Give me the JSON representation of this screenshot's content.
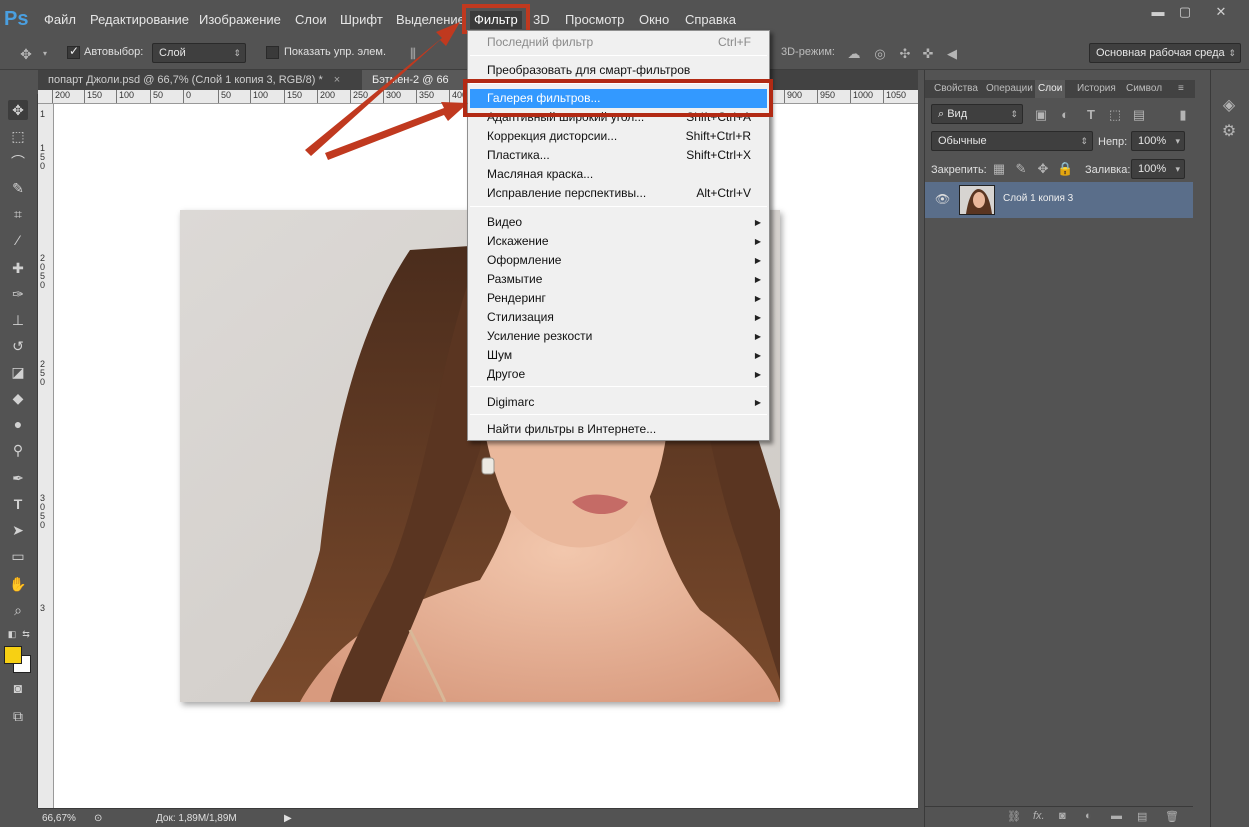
{
  "app": {
    "logo": "Ps",
    "window_controls": [
      "minimize-icon",
      "restore-icon",
      "close-icon"
    ]
  },
  "menubar": {
    "items": [
      "Файл",
      "Редактирование",
      "Изображение",
      "Слои",
      "Шрифт",
      "Выделение",
      "Фильтр",
      "3D",
      "Просмотр",
      "Окно",
      "Справка"
    ],
    "active": "Фильтр"
  },
  "options": {
    "auto_select_label": "Автовыбор:",
    "auto_select_checked": true,
    "auto_select_value": "Слой",
    "show_transform_label": "Показать упр. элем.",
    "show_transform_checked": false,
    "mode_3d_label": "3D-режим:",
    "workspace_value": "Основная рабочая среда"
  },
  "tabs": [
    {
      "label": "попарт Джоли.psd @ 66,7% (Слой 1 копия 3, RGB/8) *",
      "active": false
    },
    {
      "label": "Бэтмен-2 @ 66",
      "active": true
    }
  ],
  "ruler_h": [
    "200",
    "150",
    "100",
    "50",
    "0",
    "50",
    "100",
    "150",
    "200",
    "250",
    "300",
    "350",
    "400",
    "900",
    "950",
    "1000",
    "1050"
  ],
  "ruler_v": [
    "1",
    "1",
    "5",
    "0",
    "2",
    "0",
    "5",
    "0",
    "2",
    "5",
    "0",
    "3",
    "0",
    "5",
    "0",
    "3"
  ],
  "filter_menu": {
    "items": [
      {
        "label": "Последний фильтр",
        "shortcut": "Ctrl+F",
        "disabled": true
      },
      {
        "label": "Преобразовать для смарт-фильтров"
      },
      {
        "label": "Галерея фильтров...",
        "highlighted": true
      },
      {
        "label": "Адаптивный широкий угол...",
        "shortcut": "Shift+Ctrl+A"
      },
      {
        "label": "Коррекция дисторсии...",
        "shortcut": "Shift+Ctrl+R"
      },
      {
        "label": "Пластика...",
        "shortcut": "Shift+Ctrl+X"
      },
      {
        "label": "Масляная краска..."
      },
      {
        "label": "Исправление перспективы...",
        "shortcut": "Alt+Ctrl+V"
      },
      {
        "label": "Видео",
        "submenu": true
      },
      {
        "label": "Искажение",
        "submenu": true
      },
      {
        "label": "Оформление",
        "submenu": true
      },
      {
        "label": "Размытие",
        "submenu": true
      },
      {
        "label": "Рендеринг",
        "submenu": true
      },
      {
        "label": "Стилизация",
        "submenu": true
      },
      {
        "label": "Усиление резкости",
        "submenu": true
      },
      {
        "label": "Шум",
        "submenu": true
      },
      {
        "label": "Другое",
        "submenu": true
      },
      {
        "label": "Digimarc",
        "submenu": true
      },
      {
        "label": "Найти фильтры в Интернете..."
      }
    ]
  },
  "panels": {
    "tabs": [
      "Свойства",
      "Операции",
      "Слои",
      "История",
      "Символ"
    ],
    "active_tab": "Слои",
    "filter_kind": "Вид",
    "blend_mode": "Обычные",
    "opacity_label": "Непр:",
    "opacity_value": "100%",
    "lock_label": "Закрепить:",
    "fill_label": "Заливка:",
    "fill_value": "100%",
    "layers": [
      {
        "name": "Слой 1 копия 3",
        "visible": true,
        "selected": true
      }
    ]
  },
  "status": {
    "zoom": "66,67%",
    "doc_info": "Док: 1,89M/1,89M"
  },
  "colors": {
    "foreground": "#f7d013",
    "background": "#ffffff",
    "menu_highlight": "#3399ff",
    "annotation": "#c0391f"
  }
}
